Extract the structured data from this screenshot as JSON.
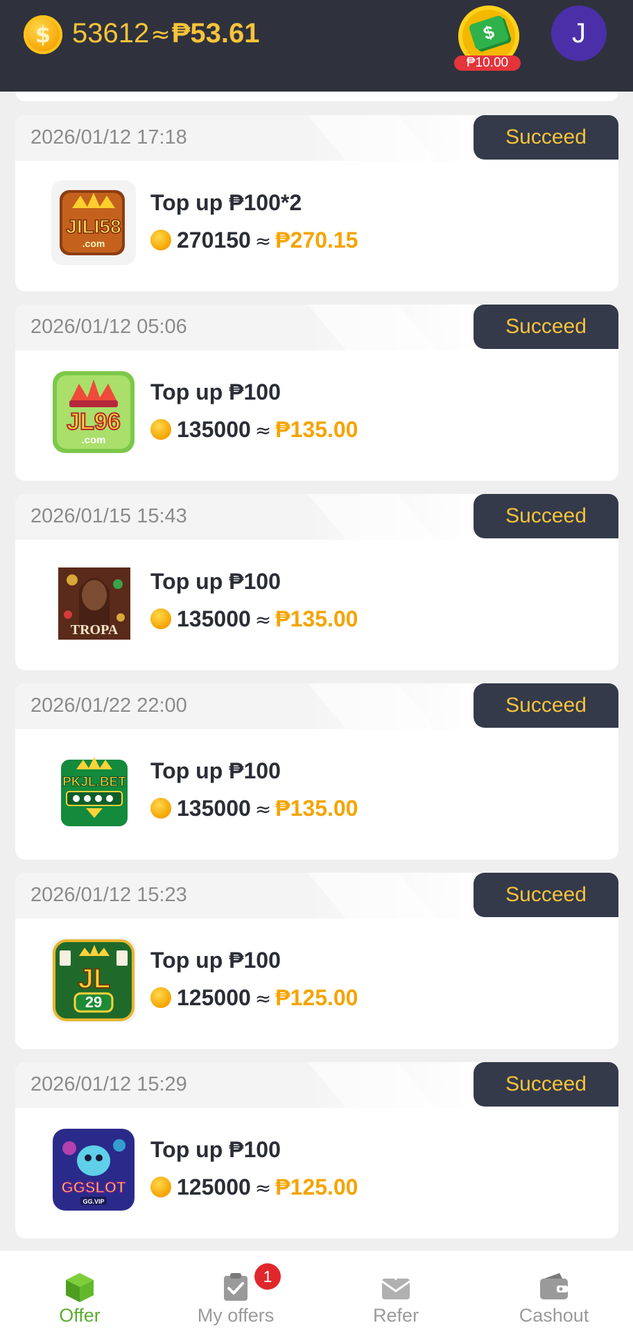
{
  "header": {
    "coin_count": "53612",
    "approx_symbol": "≈",
    "peso_value": "₱53.61",
    "cash_badge_label": "₱10.00",
    "avatar_letter": "J",
    "cash_icon": "cash-stack-icon",
    "coin_icon": "coin-icon"
  },
  "orders": [
    {
      "date": "2026/01/12 17:18",
      "status": "Succeed",
      "title": "Top up ₱100*2",
      "coins": "270150",
      "approx": "≈",
      "peso": "₱270.15",
      "logo": "JILI58"
    },
    {
      "date": "2026/01/12 05:06",
      "status": "Succeed",
      "title": "Top up ₱100",
      "coins": "135000",
      "approx": "≈",
      "peso": "₱135.00",
      "logo": "JL96"
    },
    {
      "date": "2026/01/15 15:43",
      "status": "Succeed",
      "title": "Top up ₱100",
      "coins": "135000",
      "approx": "≈",
      "peso": "₱135.00",
      "logo": "TROPA"
    },
    {
      "date": "2026/01/22 22:00",
      "status": "Succeed",
      "title": "Top up ₱100",
      "coins": "135000",
      "approx": "≈",
      "peso": "₱135.00",
      "logo": "PKJL.BET"
    },
    {
      "date": "2026/01/12 15:23",
      "status": "Succeed",
      "title": "Top up ₱100",
      "coins": "125000",
      "approx": "≈",
      "peso": "₱125.00",
      "logo": "JL 29"
    },
    {
      "date": "2026/01/12 15:29",
      "status": "Succeed",
      "title": "Top up ₱100",
      "coins": "125000",
      "approx": "≈",
      "peso": "₱125.00",
      "logo": "GGSLOT"
    }
  ],
  "nav": {
    "items": [
      {
        "label": "Offer",
        "icon": "cube-icon",
        "active": true
      },
      {
        "label": "My offers",
        "icon": "clipboard-check-icon",
        "badge": "1"
      },
      {
        "label": "Refer",
        "icon": "envelope-icon"
      },
      {
        "label": "Cashout",
        "icon": "wallet-icon"
      }
    ]
  },
  "colors": {
    "header_bg": "#2f323d",
    "accent_gold": "#f7c33a",
    "peso_orange": "#f5a400",
    "status_bg": "#343a4a",
    "nav_active": "#5cad2e",
    "badge_red": "#e0272c"
  }
}
